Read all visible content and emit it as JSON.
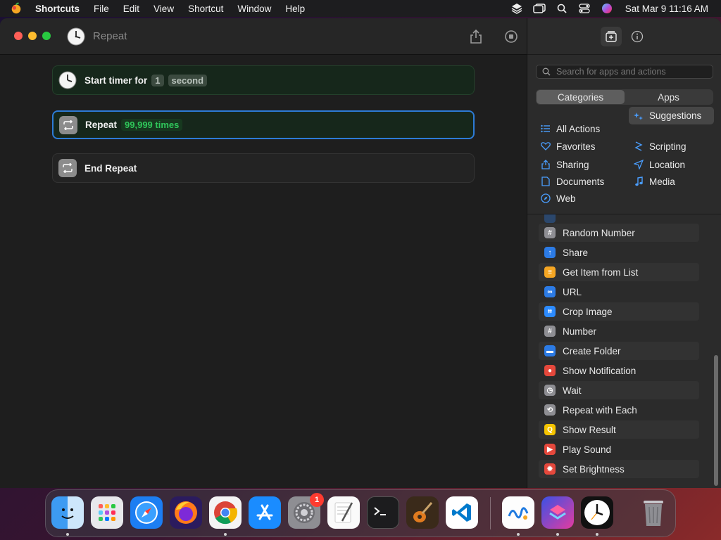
{
  "menubar": {
    "app_name": "Shortcuts",
    "items": [
      "File",
      "Edit",
      "View",
      "Shortcut",
      "Window",
      "Help"
    ],
    "datetime": "Sat Mar 9  11:16 AM"
  },
  "window": {
    "title": "Repeat"
  },
  "editor": {
    "actions": [
      {
        "label": "Start timer for",
        "token1": "1",
        "token2": "second",
        "icon": "clock-icon"
      },
      {
        "label": "Repeat",
        "token": "99,999 times",
        "icon": "repeat-icon"
      },
      {
        "label": "End Repeat",
        "icon": "repeat-icon"
      }
    ]
  },
  "sidebar": {
    "search_placeholder": "Search for apps and actions",
    "segments": [
      "Categories",
      "Apps"
    ],
    "active_segment": "Categories",
    "categories": {
      "left": [
        "All Actions",
        "Favorites",
        "Sharing",
        "Documents",
        "Web"
      ],
      "right": [
        "Suggestions",
        "Scripting",
        "Location",
        "Media"
      ]
    },
    "selected_category": "Suggestions",
    "actions": [
      {
        "label": "Random Number",
        "color": "#8e8e93"
      },
      {
        "label": "Share",
        "color": "#2c7be5"
      },
      {
        "label": "Get Item from List",
        "color": "#f5a623"
      },
      {
        "label": "URL",
        "color": "#2c7be5"
      },
      {
        "label": "Crop Image",
        "color": "#2c8bff"
      },
      {
        "label": "Number",
        "color": "#8e8e93"
      },
      {
        "label": "Create Folder",
        "color": "#2c7be5"
      },
      {
        "label": "Show Notification",
        "color": "#e5483c"
      },
      {
        "label": "Wait",
        "color": "#8e8e93"
      },
      {
        "label": "Repeat with Each",
        "color": "#8e8e93"
      },
      {
        "label": "Show Result",
        "color": "#f5c400"
      },
      {
        "label": "Play Sound",
        "color": "#e5483c"
      },
      {
        "label": "Set Brightness",
        "color": "#e5483c"
      }
    ]
  },
  "dock": {
    "apps": [
      "Finder",
      "Launchpad",
      "Safari",
      "Firefox",
      "Chrome",
      "App Store",
      "System Settings",
      "TextEdit",
      "Terminal",
      "GarageBand",
      "VS Code",
      "Freeform",
      "Shortcuts",
      "Clock",
      "Trash"
    ],
    "settings_badge": "1"
  }
}
